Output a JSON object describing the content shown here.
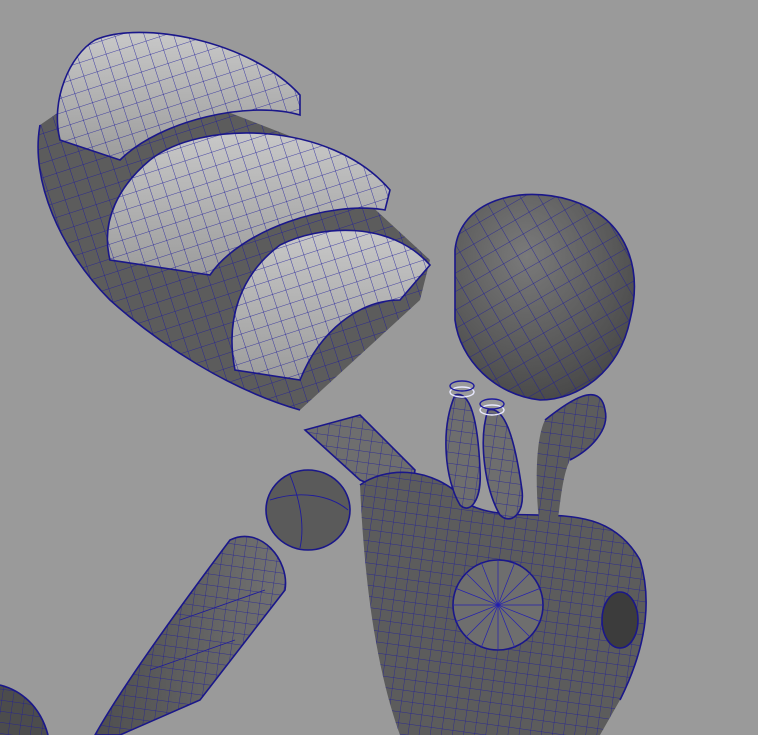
{
  "viewport": {
    "background": "#9a9a9a",
    "wireframe_color": "#1e1b9c",
    "shaded_dark": "#5c5c5c",
    "shaded_light": "#b4b4b4"
  },
  "parts": [
    {
      "name": "forearm-armor-plates",
      "icon": "armor-plate"
    },
    {
      "name": "head-sphere",
      "icon": "sphere"
    },
    {
      "name": "neck-cylinders",
      "icon": "cylinder"
    },
    {
      "name": "torso-chest",
      "icon": "torso"
    },
    {
      "name": "upper-arm",
      "icon": "limb"
    },
    {
      "name": "chest-disc",
      "icon": "disc"
    }
  ]
}
